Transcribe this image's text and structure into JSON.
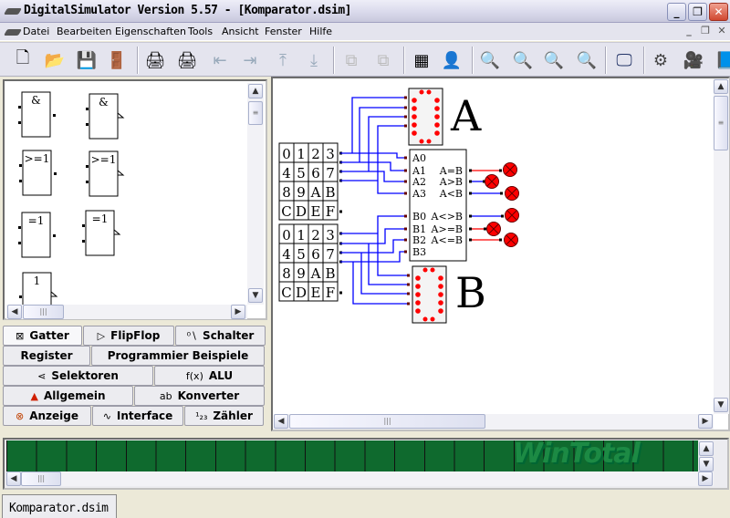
{
  "window": {
    "title": "DigitalSimulator Version 5.57 - [Komparator.dsim]",
    "minimize": "_",
    "restore": "❐",
    "close": "✕"
  },
  "menu": [
    "Datei",
    "Bearbeiten",
    "Eigenschaften",
    "Tools",
    "Ansicht",
    "Fenster",
    "Hilfe"
  ],
  "toolbar": [
    {
      "icon": "new-file-icon",
      "glyph": "🗋"
    },
    {
      "icon": "open-folder-icon",
      "glyph": "📂"
    },
    {
      "icon": "save-icon",
      "glyph": "💾"
    },
    {
      "icon": "exit-icon",
      "glyph": "🚪"
    },
    {
      "icon": "print-icon",
      "glyph": "🖨"
    },
    {
      "icon": "print-timing-icon",
      "glyph": "🖨"
    },
    {
      "icon": "arrow-left-icon",
      "glyph": "⇤"
    },
    {
      "icon": "arrow-right-icon",
      "glyph": "⇥"
    },
    {
      "icon": "arrow-up-icon",
      "glyph": "⤒"
    },
    {
      "icon": "arrow-down-icon",
      "glyph": "⤓"
    },
    {
      "icon": "copy-icon",
      "glyph": "⧉"
    },
    {
      "icon": "paste-icon",
      "glyph": "⧉"
    },
    {
      "icon": "grid-icon",
      "glyph": "▦"
    },
    {
      "icon": "user-key-icon",
      "glyph": "👤"
    },
    {
      "icon": "zoom-1-1-icon",
      "glyph": "🔍"
    },
    {
      "icon": "zoom-icon",
      "glyph": "🔍"
    },
    {
      "icon": "zoom-in-icon",
      "glyph": "🔍"
    },
    {
      "icon": "zoom-out-icon",
      "glyph": "🔍"
    },
    {
      "icon": "screen-icon",
      "glyph": "🖵"
    },
    {
      "icon": "gear-icon",
      "glyph": "⚙"
    },
    {
      "icon": "camera-icon",
      "glyph": "🎥"
    },
    {
      "icon": "book-icon",
      "glyph": "📘"
    }
  ],
  "palette": {
    "gates": [
      {
        "label": "&"
      },
      {
        "label": "&"
      },
      {
        "label": ">=1"
      },
      {
        "label": ">=1"
      },
      {
        "label": "=1"
      },
      {
        "label": "=1"
      },
      {
        "label": "1"
      }
    ]
  },
  "tabs": [
    [
      {
        "label": "Gatter",
        "icon": "gate-icon",
        "glyph": "⊠"
      },
      {
        "label": "FlipFlop",
        "icon": "flipflop-icon",
        "glyph": "▷"
      },
      {
        "label": "Schalter",
        "icon": "switch-icon",
        "glyph": "⁰∖"
      }
    ],
    [
      {
        "label": "Register",
        "icon": "",
        "glyph": ""
      },
      {
        "label": "Programmier Beispiele",
        "icon": "",
        "glyph": ""
      }
    ],
    [
      {
        "label": "Selektoren",
        "icon": "selector-icon",
        "glyph": "⋖"
      },
      {
        "label": "ALU",
        "icon": "function-icon",
        "glyph": "f(x)"
      }
    ],
    [
      {
        "label": "Allgemein",
        "icon": "shapes-icon",
        "glyph": "▲"
      },
      {
        "label": "Konverter",
        "icon": "converter-icon",
        "glyph": "ab"
      }
    ],
    [
      {
        "label": "Anzeige",
        "icon": "lamp-icon",
        "glyph": "⊗"
      },
      {
        "label": "Interface",
        "icon": "interface-icon",
        "glyph": "∿"
      },
      {
        "label": "Zähler",
        "icon": "counter-icon",
        "glyph": "¹₂₃"
      }
    ]
  ],
  "circuit": {
    "keypad": [
      "0",
      "1",
      "2",
      "3",
      "4",
      "5",
      "6",
      "7",
      "8",
      "9",
      "A",
      "B",
      "C",
      "D",
      "E",
      "F"
    ],
    "display_a_label": "A",
    "display_b_label": "B",
    "inputs": [
      "A0",
      "A1",
      "A2",
      "A3",
      "B0",
      "B1",
      "B2",
      "B3"
    ],
    "outputs": [
      "A=B",
      "A>B",
      "A<B",
      "A<>B",
      "A>=B",
      "A<=B"
    ],
    "colors": {
      "wire_low": "#0000ff",
      "wire_high": "#ff0000",
      "lamp": "#ff0000"
    }
  },
  "watermark": "WinTotal",
  "status": {
    "document_tab": "Komparator.dsim"
  }
}
